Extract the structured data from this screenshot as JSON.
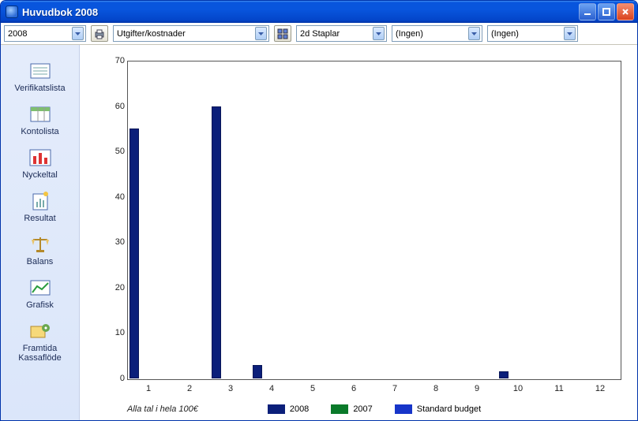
{
  "window": {
    "title": "Huvudbok 2008"
  },
  "toolbar": {
    "year_combo": "2008",
    "category_combo": "Utgifter/kostnader",
    "chart_type_combo": "2d Staplar",
    "filter1_combo": "(Ingen)",
    "filter2_combo": "(Ingen)"
  },
  "sidebar": {
    "items": [
      {
        "label": "Verifikatslista"
      },
      {
        "label": "Kontolista"
      },
      {
        "label": "Nyckeltal"
      },
      {
        "label": "Resultat"
      },
      {
        "label": "Balans"
      },
      {
        "label": "Grafisk"
      },
      {
        "label": "Framtida\nKassaflöde"
      }
    ]
  },
  "chart_data": {
    "type": "bar",
    "categories": [
      "1",
      "2",
      "3",
      "4",
      "5",
      "6",
      "7",
      "8",
      "9",
      "10",
      "11",
      "12"
    ],
    "series": [
      {
        "name": "2008",
        "color": "#0b1f7a",
        "values": [
          55,
          0,
          60,
          3,
          0,
          0,
          0,
          0,
          0,
          1.5,
          0,
          0
        ]
      },
      {
        "name": "2007",
        "color": "#0a7a2a",
        "values": [
          0,
          0,
          0,
          0,
          0,
          0,
          0,
          0,
          0,
          0,
          0,
          0
        ]
      },
      {
        "name": "Standard budget",
        "color": "#1735c9",
        "values": [
          0,
          0,
          0,
          0,
          0,
          0,
          0,
          0,
          0,
          0,
          0,
          0
        ]
      }
    ],
    "ylim": [
      0,
      70
    ],
    "yticks": [
      0,
      10,
      20,
      30,
      40,
      50,
      60,
      70
    ],
    "xlabel": "",
    "ylabel": "",
    "title": "",
    "footnote": "Alla tal i hela 100€"
  }
}
